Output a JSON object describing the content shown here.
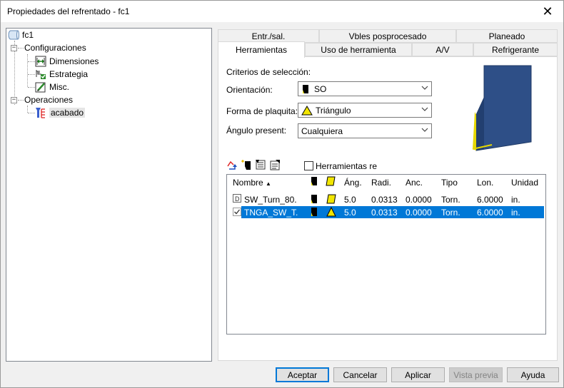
{
  "window": {
    "title": "Propiedades del refrentado - fc1",
    "close_label": "✕"
  },
  "tree": {
    "root": "fc1",
    "config": "Configuraciones",
    "items": [
      "Dimensiones",
      "Estrategia",
      "Misc."
    ],
    "ops": "Operaciones",
    "op_item": "acabado"
  },
  "tabs": {
    "row1": [
      "Entr./sal.",
      "Vbles posprocesado",
      "Planeado"
    ],
    "row2": [
      "Herramientas",
      "Uso de herramienta",
      "A/V",
      "Refrigerante"
    ]
  },
  "criteria": {
    "heading": "Criterios de selección:",
    "orientation_label": "Orientación:",
    "orientation_value": "SO",
    "insert_label": "Forma de plaquita:",
    "insert_value": "Triángulo",
    "angle_label": "Ángulo present:",
    "angle_value": "Cualquiera"
  },
  "tools_check_label": "Herramientas re",
  "table": {
    "headers": [
      "Nombre",
      "Áng.",
      "Radi.",
      "Anc.",
      "Tipo",
      "Lon.",
      "Unidad"
    ],
    "sort_arrow": "▲",
    "rows": [
      {
        "name": "SW_Turn_80.",
        "ang": "5.0",
        "radi": "0.0313",
        "anc": "0.0000",
        "tipo": "Torn.",
        "lon": "6.0000",
        "unidad": "in."
      },
      {
        "name": "TNGA_SW_T.",
        "ang": "5.0",
        "radi": "0.0313",
        "anc": "0.0000",
        "tipo": "Torn.",
        "lon": "6.0000",
        "unidad": "in."
      }
    ]
  },
  "buttons": {
    "ok": "Aceptar",
    "cancel": "Cancelar",
    "apply": "Aplicar",
    "preview": "Vista previa",
    "help": "Ayuda"
  },
  "colors": {
    "accent": "#0078d7",
    "tool_blue": "#2e4f87",
    "tool_yellow": "#f2e600"
  }
}
